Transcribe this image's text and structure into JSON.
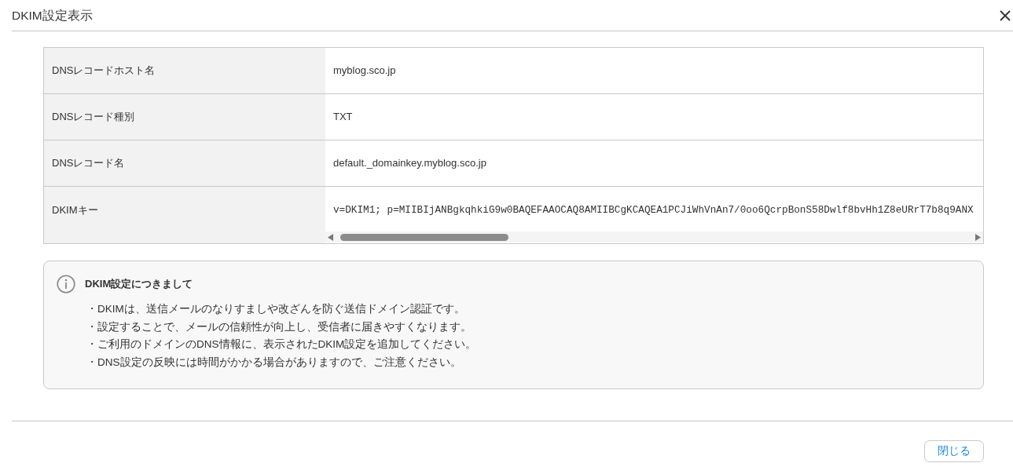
{
  "dialog": {
    "title": "DKIM設定表示"
  },
  "table": {
    "rows": [
      {
        "kind": "text",
        "label": "DNSレコードホスト名",
        "value": "myblog.sco.jp"
      },
      {
        "kind": "text",
        "label": "DNSレコード種別",
        "value": "TXT"
      },
      {
        "kind": "text",
        "label": "DNSレコード名",
        "value": "default._domainkey.myblog.sco.jp"
      },
      {
        "kind": "key",
        "label": "DKIMキー",
        "value": "v=DKIM1; p=MIIBIjANBgkqhkiG9w0BAQEFAAOCAQ8AMIIBCgKCAQEA1PCJiWhVnAn7/0oo6QcrpBonS58Dwlf8bvHh1Z8eURrT7b8q9ANX"
      }
    ]
  },
  "notice": {
    "title": "DKIM設定につきまして",
    "items": [
      "・DKIMは、送信メールのなりすましや改ざんを防ぐ送信ドメイン認証です。",
      "・設定することで、メールの信頼性が向上し、受信者に届きやすくなります。",
      "・ご利用のドメインのDNS情報に、表示されたDKIM設定を追加してください。",
      "・DNS設定の反映には時間がかかる場合がありますので、ご注意ください。"
    ]
  },
  "footer": {
    "buttons": [
      "閉じる"
    ]
  }
}
